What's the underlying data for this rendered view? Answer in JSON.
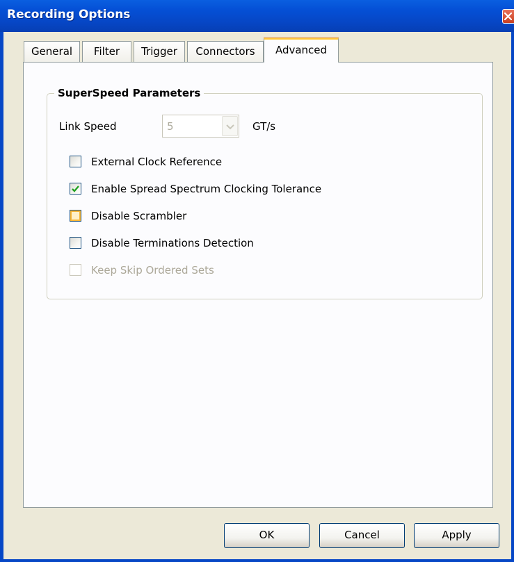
{
  "window": {
    "title": "Recording Options"
  },
  "tabs": [
    {
      "label": "General",
      "active": false
    },
    {
      "label": "Filter",
      "active": false
    },
    {
      "label": "Trigger",
      "active": false
    },
    {
      "label": "Connectors",
      "active": false
    },
    {
      "label": "Advanced",
      "active": true
    }
  ],
  "group": {
    "title": "SuperSpeed Parameters",
    "link_speed_label": "Link Speed",
    "link_speed_value": "5",
    "link_speed_unit": "GT/s",
    "checkboxes": [
      {
        "label": "External Clock Reference",
        "checked": false,
        "enabled": true
      },
      {
        "label": "Enable Spread Spectrum Clocking Tolerance",
        "checked": true,
        "enabled": true
      },
      {
        "label": "Disable Scrambler",
        "checked": false,
        "enabled": true
      },
      {
        "label": "Disable Terminations Detection",
        "checked": false,
        "enabled": true
      },
      {
        "label": "Keep Skip Ordered Sets",
        "checked": false,
        "enabled": false
      }
    ]
  },
  "buttons": {
    "ok": "OK",
    "cancel": "Cancel",
    "apply": "Apply"
  },
  "colors": {
    "titlebar": "#0550d6",
    "tab_highlight": "#ffc83c",
    "check": "#21a121"
  },
  "icons": {
    "close": "close-icon",
    "dropdown": "chevron-down-icon",
    "check": "checkmark-icon"
  }
}
